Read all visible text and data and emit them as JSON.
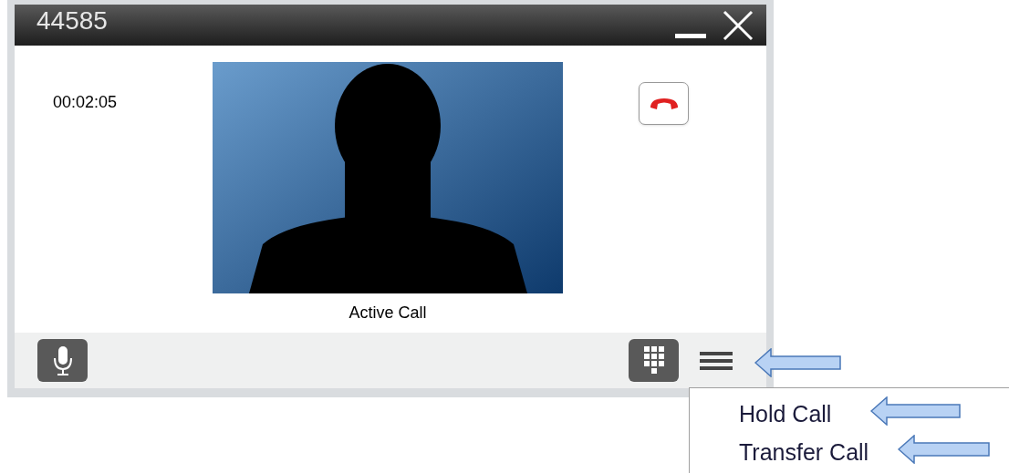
{
  "window": {
    "title": "44585"
  },
  "call": {
    "timer": "00:02:05",
    "status": "Active Call"
  },
  "menu": {
    "items": [
      {
        "label": "Hold Call"
      },
      {
        "label": "Transfer Call"
      }
    ]
  }
}
